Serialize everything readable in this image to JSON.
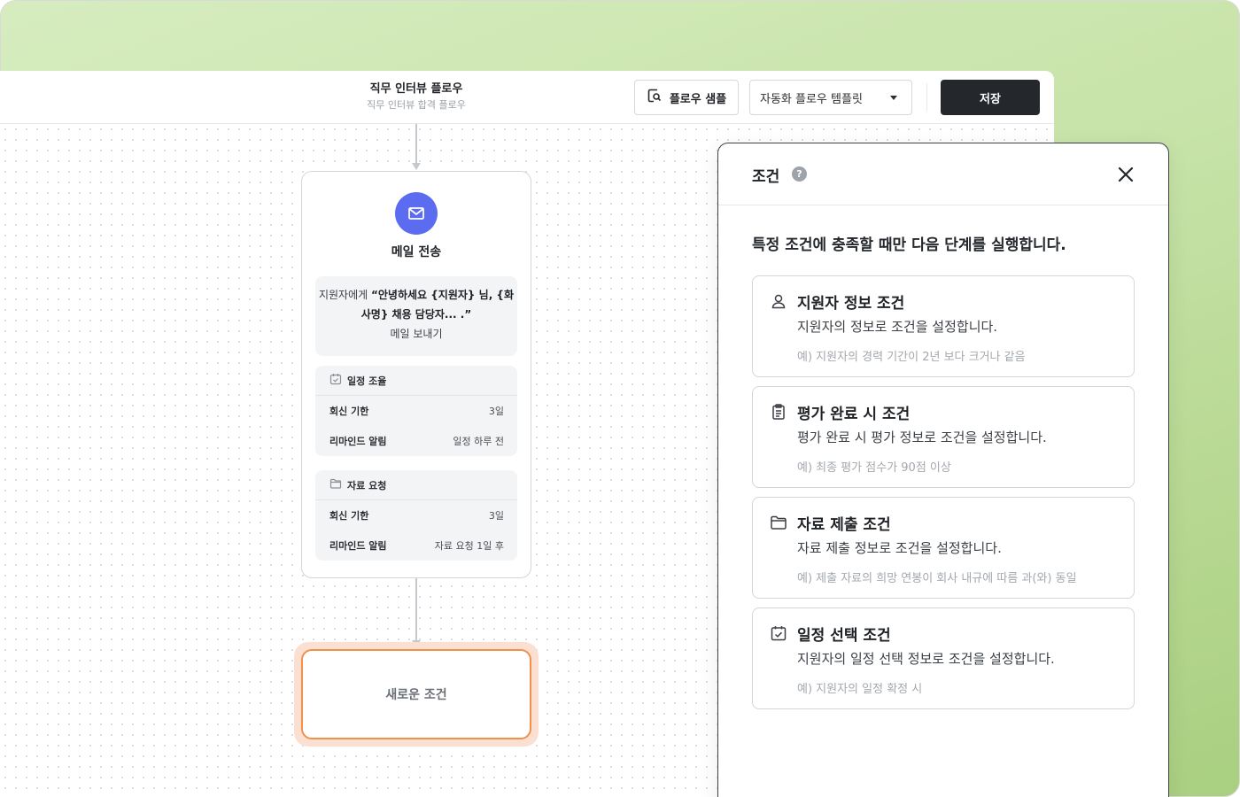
{
  "header": {
    "flow_title": "직무 인터뷰 플로우",
    "flow_subtitle": "직무 인터뷰 합격 플로우",
    "sample_button_label": "플로우 샘플",
    "template_select_value": "자동화 플로우 템플릿",
    "save_button_label": "저장"
  },
  "email_node": {
    "title": "메일 전송",
    "message_prefix": "지원자에게",
    "message_quote": "“안녕하세요 {지원자} 님, {화사명} 채용 담당자... .”",
    "message_suffix": "메일 보내기",
    "schedule": {
      "label": "일정 조율",
      "rows": [
        {
          "key": "회신 기한",
          "value": "3일"
        },
        {
          "key": "리마인드 알림",
          "value": "일정 하루 전"
        }
      ]
    },
    "documents": {
      "label": "자료 요청",
      "rows": [
        {
          "key": "회신 기한",
          "value": "3일"
        },
        {
          "key": "리마인드 알림",
          "value": "자료 요청 1일 후"
        }
      ]
    }
  },
  "new_condition_node": {
    "label": "새로운 조건"
  },
  "panel": {
    "title": "조건",
    "help_symbol": "?",
    "description": "특정 조건에 충족할 때만 다음 단계를 실행합니다.",
    "conditions": [
      {
        "icon": "user-icon",
        "title": "지원자 정보 조건",
        "subtitle": "지원자의 정보로 조건을 설정합니다.",
        "example": "예) 지원자의 경력 기간이 2년 보다 크거나 같음"
      },
      {
        "icon": "clipboard-icon",
        "title": "평가 완료 시 조건",
        "subtitle": "평가 완료 시 평가 정보로 조건을 설정합니다.",
        "example": "예) 최종 평가 점수가 90점 이상"
      },
      {
        "icon": "folder-icon",
        "title": "자료 제출 조건",
        "subtitle": "자료 제출 정보로 조건을 설정합니다.",
        "example": "예) 제출 자료의 희망 연봉이 회사 내규에 따름 과(와) 동일"
      },
      {
        "icon": "calendar-check-icon",
        "title": "일정 선택 조건",
        "subtitle": "지원자의 일정 선택 정보로 조건을 설정합니다.",
        "example": "예) 지원자의 일정 확정 시"
      }
    ]
  },
  "colors": {
    "accent_mail": "#5b6cf0",
    "new_condition_border": "#f0904a",
    "save_button": "#24272b",
    "background_green": "#c7e3a8"
  }
}
